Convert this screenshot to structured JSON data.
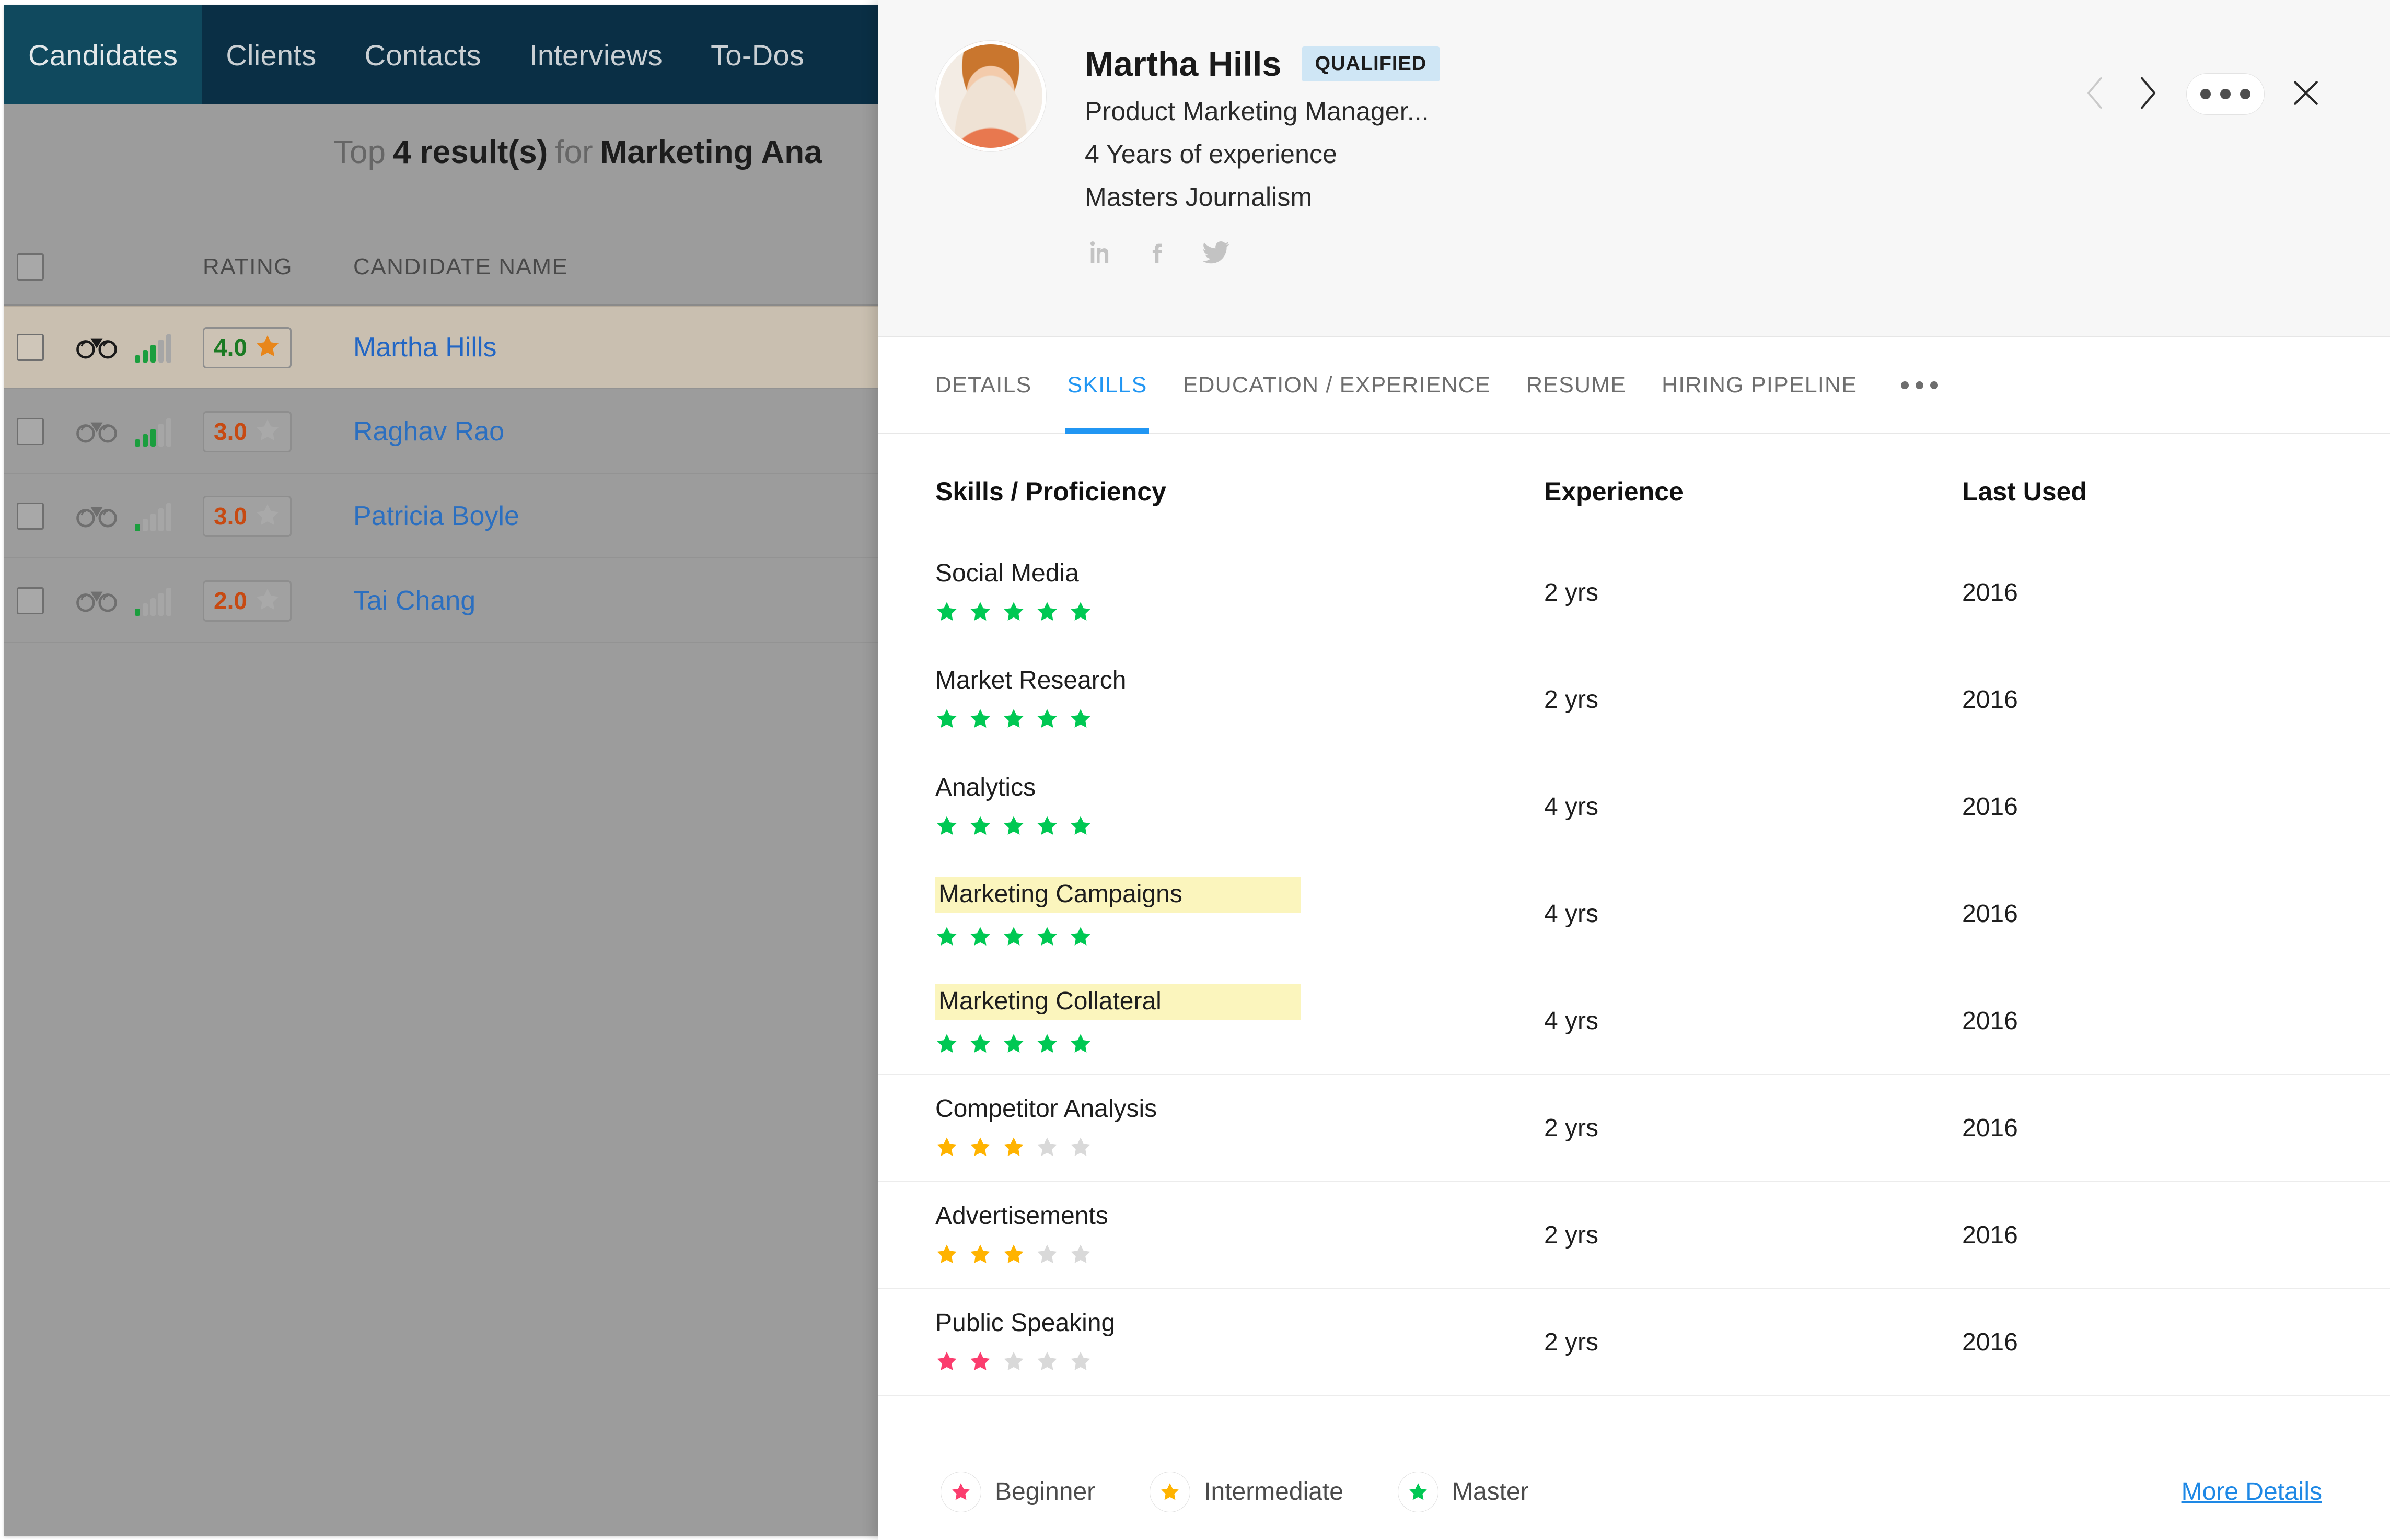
{
  "colors": {
    "nav_bg": "#0a2f45",
    "nav_active": "#10495e",
    "accent_blue": "#2196f3",
    "link_blue": "#2b6fc0",
    "star_master": "#00c853",
    "star_intermediate": "#ffb300",
    "star_beginner": "#fb3d6e",
    "star_empty": "#d9d9d9",
    "highlight_yellow": "#fbf5bd",
    "badge_bg": "#cfe6f5",
    "rating_orange": "#c74a12",
    "rating_green": "#1b7a23"
  },
  "background_app": {
    "nav_items": [
      {
        "label": "Candidates",
        "active": true
      },
      {
        "label": "Clients",
        "active": false
      },
      {
        "label": "Contacts",
        "active": false
      },
      {
        "label": "Interviews",
        "active": false
      },
      {
        "label": "To-Dos",
        "active": false
      }
    ],
    "results_title": {
      "prefix": "Top",
      "count": "4 result(s)",
      "middle": "for",
      "query": "Marketing Ana"
    },
    "table": {
      "headers": {
        "rating": "RATING",
        "candidate_name": "CANDIDATE NAME"
      },
      "rows": [
        {
          "rating": "4.0",
          "starred": true,
          "name": "Martha Hills",
          "selected": true,
          "signal": 3
        },
        {
          "rating": "3.0",
          "starred": false,
          "name": "Raghav Rao",
          "selected": false,
          "signal": 3
        },
        {
          "rating": "3.0",
          "starred": false,
          "name": "Patricia Boyle",
          "selected": false,
          "signal": 1
        },
        {
          "rating": "2.0",
          "starred": false,
          "name": "Tai Chang",
          "selected": false,
          "signal": 1
        }
      ]
    }
  },
  "panel": {
    "candidate": {
      "name": "Martha Hills",
      "status": "QUALIFIED",
      "title": "Product Marketing Manager...",
      "experience": "4 Years of experience",
      "education": "Masters Journalism",
      "socials": [
        "linkedin-icon",
        "facebook-icon",
        "twitter-icon"
      ]
    },
    "actions": {
      "prev": "chevron-left-icon",
      "next": "chevron-right-icon",
      "more": "more-horizontal-icon",
      "close": "close-icon"
    },
    "tabs": [
      {
        "label": "DETAILS",
        "active": false
      },
      {
        "label": "SKILLS",
        "active": true
      },
      {
        "label": "EDUCATION / EXPERIENCE",
        "active": false
      },
      {
        "label": "RESUME",
        "active": false
      },
      {
        "label": "HIRING PIPELINE",
        "active": false
      }
    ],
    "skills_table": {
      "headers": {
        "skill": "Skills / Proficiency",
        "experience": "Experience",
        "last_used": "Last Used"
      },
      "rows": [
        {
          "skill": "Social Media",
          "highlight": false,
          "filled": 5,
          "level": "master",
          "experience": "2 yrs",
          "last_used": "2016"
        },
        {
          "skill": "Market Research",
          "highlight": false,
          "filled": 5,
          "level": "master",
          "experience": "2 yrs",
          "last_used": "2016"
        },
        {
          "skill": "Analytics",
          "highlight": false,
          "filled": 5,
          "level": "master",
          "experience": "4 yrs",
          "last_used": "2016"
        },
        {
          "skill": "Marketing Campaigns",
          "highlight": true,
          "filled": 5,
          "level": "master",
          "experience": "4 yrs",
          "last_used": "2016"
        },
        {
          "skill": "Marketing Collateral",
          "highlight": true,
          "filled": 5,
          "level": "master",
          "experience": "4 yrs",
          "last_used": "2016"
        },
        {
          "skill": "Competitor Analysis",
          "highlight": false,
          "filled": 3,
          "level": "intermediate",
          "experience": "2 yrs",
          "last_used": "2016"
        },
        {
          "skill": "Advertisements",
          "highlight": false,
          "filled": 3,
          "level": "intermediate",
          "experience": "2 yrs",
          "last_used": "2016"
        },
        {
          "skill": "Public Speaking",
          "highlight": false,
          "filled": 2,
          "level": "beginner",
          "experience": "2 yrs",
          "last_used": "2016"
        }
      ]
    },
    "legend": [
      {
        "label": "Beginner",
        "level": "beginner"
      },
      {
        "label": "Intermediate",
        "level": "intermediate"
      },
      {
        "label": "Master",
        "level": "master"
      }
    ],
    "more_details_label": "More Details"
  }
}
